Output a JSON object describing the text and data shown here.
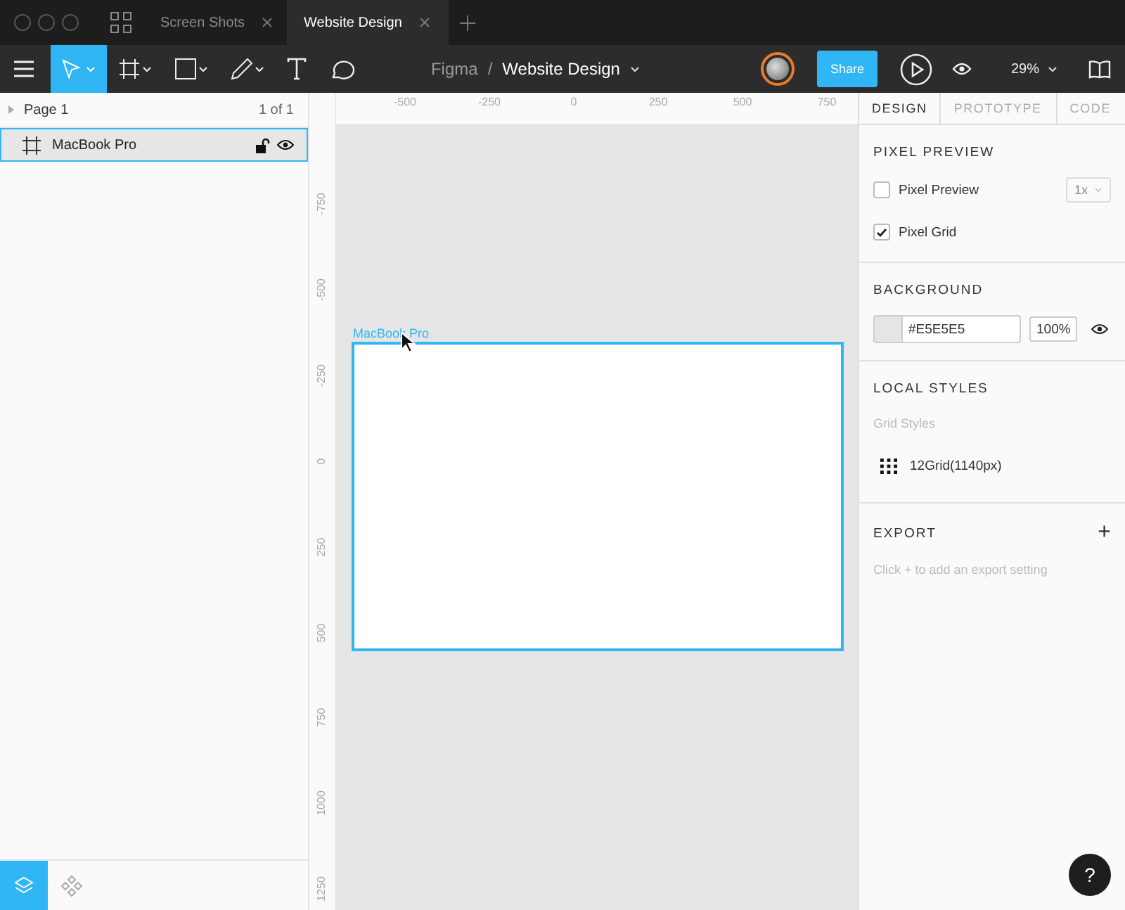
{
  "window": {
    "tabs": [
      {
        "label": "Screen Shots",
        "selected": false
      },
      {
        "label": "Website Design",
        "selected": true
      }
    ]
  },
  "toolbar": {
    "tools": [
      {
        "kind": "move",
        "selected": true
      },
      {
        "kind": "frame",
        "selected": false
      },
      {
        "kind": "shape",
        "selected": false
      },
      {
        "kind": "pen",
        "selected": false
      },
      {
        "kind": "text",
        "selected": false
      },
      {
        "kind": "comment",
        "selected": false
      }
    ],
    "project": "Figma",
    "separator": "/",
    "file": "Website Design",
    "share": "Share",
    "zoom": "29%"
  },
  "layers": {
    "page": "Page 1",
    "page_count": "1 of 1",
    "items": [
      {
        "name": "MacBook Pro",
        "selected": true
      }
    ]
  },
  "canvas": {
    "xticks": [
      "-500",
      "-250",
      "0",
      "250",
      "500",
      "750"
    ],
    "yticks": [
      "-750",
      "-500",
      "-250",
      "0",
      "250",
      "500",
      "750",
      "1000",
      "1250"
    ],
    "frame_label": "MacBook Pro"
  },
  "panel": {
    "tabs": [
      {
        "label": "DESIGN",
        "selected": true
      },
      {
        "label": "PROTOTYPE",
        "selected": false
      },
      {
        "label": "CODE",
        "selected": false
      }
    ],
    "pixel_preview": {
      "title": "PIXEL PREVIEW",
      "options": [
        {
          "label": "Pixel Preview",
          "checked": false
        },
        {
          "label": "Pixel Grid",
          "checked": true
        }
      ],
      "scale": "1x"
    },
    "background": {
      "title": "BACKGROUND",
      "color": "#e5e5e5",
      "hex": "#E5E5E5",
      "opacity": "100%"
    },
    "local_styles": {
      "title": "LOCAL STYLES",
      "group": "Grid Styles",
      "items": [
        "12Grid(1140px)"
      ]
    },
    "export": {
      "title": "EXPORT",
      "plus": "+",
      "hint": "Click + to add an export setting"
    }
  },
  "bottom_tabs": [
    {
      "kind": "layers",
      "selected": true
    },
    {
      "kind": "components",
      "selected": false
    }
  ],
  "help": "?"
}
